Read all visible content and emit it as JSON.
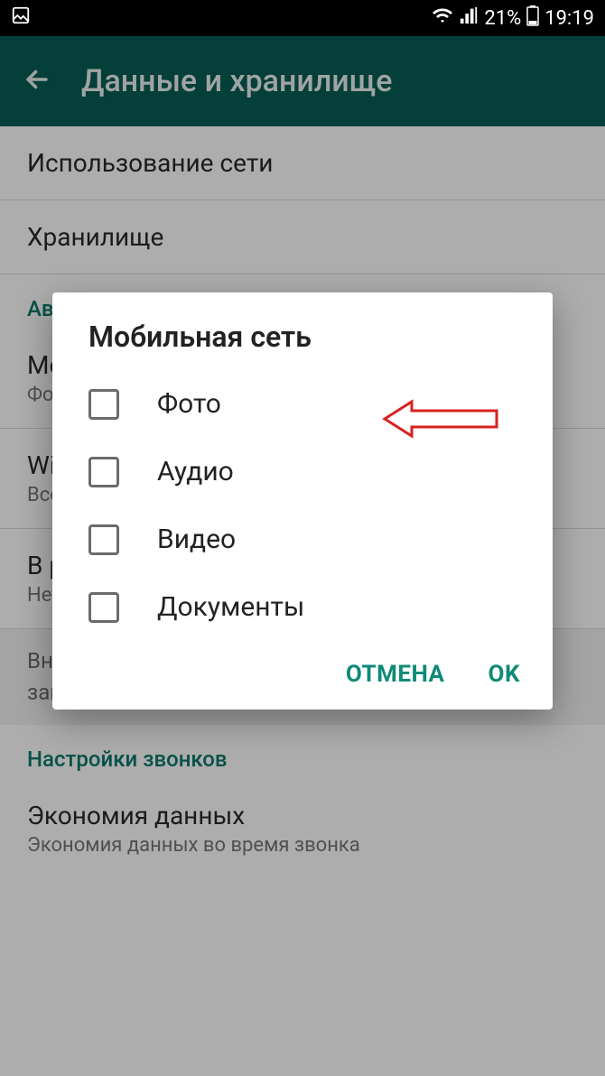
{
  "status": {
    "battery_pct": "21%",
    "time": "19:19"
  },
  "header": {
    "title": "Данные и хранилище"
  },
  "settings": {
    "row_network_usage": "Использование сети",
    "row_storage": "Хранилище",
    "section_autoload": "Автозагрузка медиа",
    "row_mobile": "Мобильная сеть",
    "row_mobile_sub": "Фото",
    "row_wifi": "Wi-Fi",
    "row_wifi_sub": "Все медиа",
    "row_roaming": "В роуминге",
    "row_roaming_sub": "Нет",
    "info": "Внимание: голосовые сообщения всегда загружаются автоматически",
    "section_calls": "Настройки звонков",
    "row_data_saving": "Экономия данных",
    "row_data_saving_sub": "Экономия данных во время звонка"
  },
  "dialog": {
    "title": "Мобильная сеть",
    "options": {
      "photo": "Фото",
      "audio": "Аудио",
      "video": "Видео",
      "docs": "Документы"
    },
    "cancel": "ОТМЕНА",
    "ok": "OK"
  }
}
